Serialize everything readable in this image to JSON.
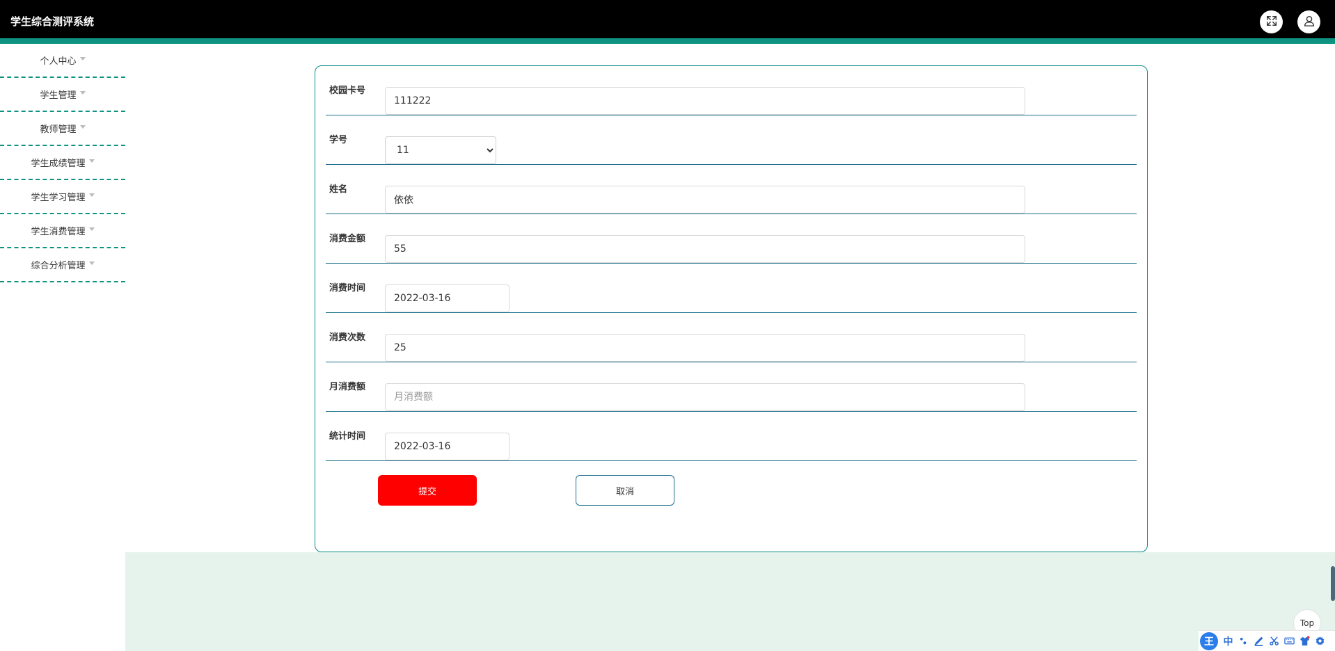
{
  "header": {
    "app_title": "学生综合测评系统",
    "fullscreen_icon": "expand-icon",
    "user_icon": "user-icon"
  },
  "sidebar": {
    "items": [
      {
        "label": "个人中心"
      },
      {
        "label": "学生管理"
      },
      {
        "label": "教师管理"
      },
      {
        "label": "学生成绩管理"
      },
      {
        "label": "学生学习管理"
      },
      {
        "label": "学生消费管理"
      },
      {
        "label": "综合分析管理"
      }
    ]
  },
  "form": {
    "campus_card": {
      "label": "校园卡号",
      "value": "111222"
    },
    "student_id": {
      "label": "学号",
      "selected": "11"
    },
    "name": {
      "label": "姓名",
      "value": "依依"
    },
    "amount": {
      "label": "消费金额",
      "value": "55"
    },
    "consume_time": {
      "label": "消费时间",
      "value": "2022-03-16"
    },
    "count": {
      "label": "消费次数",
      "value": "25"
    },
    "monthly": {
      "label": "月消费额",
      "value": "",
      "placeholder": "月消费额"
    },
    "stat_time": {
      "label": "统计时间",
      "value": "2022-03-16"
    },
    "submit_label": "提交",
    "cancel_label": "取消"
  },
  "footer": {
    "top_label": "Top"
  },
  "ime": {
    "logo": "王",
    "mode": "中"
  },
  "colors": {
    "accent": "#0e9383",
    "submit": "#ff0000",
    "footer_bg": "#e5f3ec"
  }
}
